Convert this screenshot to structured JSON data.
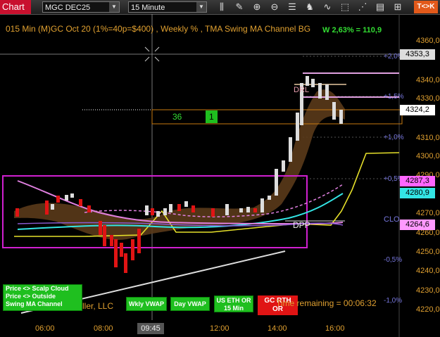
{
  "toolbar": {
    "tab_label": "Chart",
    "instrument": "MGC DEC25",
    "interval": "15 Minute",
    "tk_button": "T<>K",
    "icons": [
      "bars-icon",
      "pencil-icon",
      "zoom-in-icon",
      "zoom-out-icon",
      "properties-icon",
      "strategy-icon",
      "indicator-icon",
      "drawing-icon",
      "align-icon",
      "layout-icon",
      "data-box-icon",
      "grid-icon"
    ]
  },
  "chart": {
    "header": "015 Min (M)GC  Oct 20 (1%=40p=$400) , Weekly % , TMA Swing MA Channel BG",
    "ratio": "W 2,63% = 110,9",
    "trade_box_value": "36",
    "trade_box_count": "1",
    "labels": {
      "drl": "DRL",
      "dpp": "DPP",
      "clo": "CLO"
    },
    "time_remaining": "Time remaining = 00:06:32",
    "company": "ller, LLC",
    "crosshair_time": "09:45",
    "price_axis": [
      "4360,0",
      "4340,0",
      "4330,0",
      "4310,0",
      "4300,0",
      "4290,0",
      "4270,0",
      "4260,0",
      "4250,0",
      "4240,0",
      "4230,0",
      "4220,0"
    ],
    "price_tags": [
      {
        "value": "4353,3",
        "bg": "#dddddd",
        "fg": "#000000"
      },
      {
        "value": "4324,2",
        "bg": "#ffffff",
        "fg": "#000000"
      },
      {
        "value": "4287,3",
        "bg": "#ff66ff",
        "fg": "#000000"
      },
      {
        "value": "4280,9",
        "bg": "#33e5e5",
        "fg": "#000000"
      },
      {
        "value": "4264,6",
        "bg": "#ff99ff",
        "fg": "#000000"
      }
    ],
    "pct_labels": [
      "+2,0%",
      "+1,5%",
      "+1,0%",
      "+0,5%",
      "-0,5%",
      "-1,0%"
    ],
    "time_axis": [
      "06:00",
      "08:00",
      "12:00",
      "14:00",
      "16:00"
    ],
    "buttons": {
      "scalp_line1": "Price <> Scalp Cloud",
      "scalp_line2": "Price <> Outside",
      "scalp_line3": "Swing MA Channel",
      "wkly_vwap": "Wkly VWAP",
      "day_vwap": "Day VWAP",
      "us_eth_line1": "US ETH OR",
      "us_eth_line2": "15 Min",
      "gc_rth_line1": "GC RTH",
      "gc_rth_line2": "OR"
    }
  }
}
